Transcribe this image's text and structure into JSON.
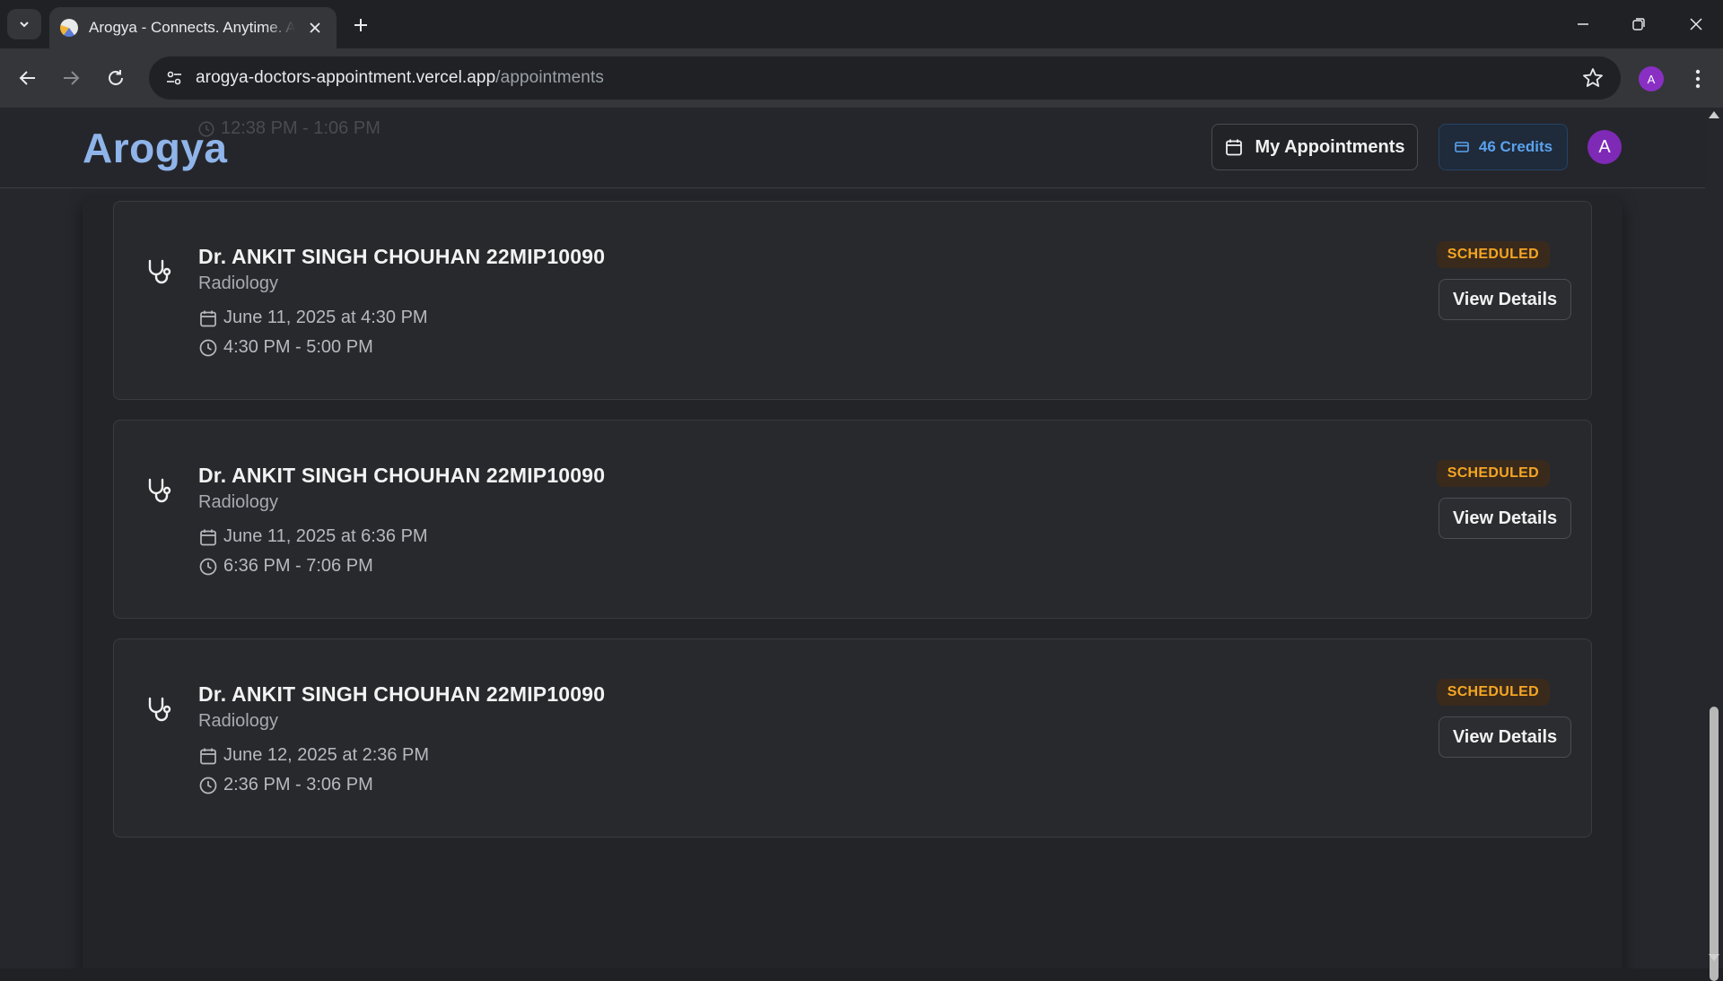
{
  "browser": {
    "tab_title": "Arogya - Connects. Anytime. Anywhere.",
    "url_host": "arogya-doctors-appointment.vercel.app",
    "url_path": "/appointments",
    "profile_initial": "A"
  },
  "header": {
    "brand": "Arogya",
    "ghost_time": "12:38 PM - 1:06 PM",
    "my_appointments_label": "My Appointments",
    "credits_label": "46 Credits",
    "avatar_initial": "A"
  },
  "appointments": [
    {
      "doctor": "Dr. ANKIT SINGH CHOUHAN 22MIP10090",
      "specialty": "Radiology",
      "date": "June 11, 2025 at 4:30 PM",
      "time": "4:30 PM - 5:00 PM",
      "status": "SCHEDULED",
      "action": "View Details"
    },
    {
      "doctor": "Dr. ANKIT SINGH CHOUHAN 22MIP10090",
      "specialty": "Radiology",
      "date": "June 11, 2025 at 6:36 PM",
      "time": "6:36 PM - 7:06 PM",
      "status": "SCHEDULED",
      "action": "View Details"
    },
    {
      "doctor": "Dr. ANKIT SINGH CHOUHAN 22MIP10090",
      "specialty": "Radiology",
      "date": "June 12, 2025 at 2:36 PM",
      "time": "2:36 PM - 3:06 PM",
      "status": "SCHEDULED",
      "action": "View Details"
    }
  ],
  "colors": {
    "brand": "#8fb4ea",
    "status_scheduled": "#f5a623",
    "credits": "#5aa2ee",
    "avatar": "#7e2ab6"
  }
}
